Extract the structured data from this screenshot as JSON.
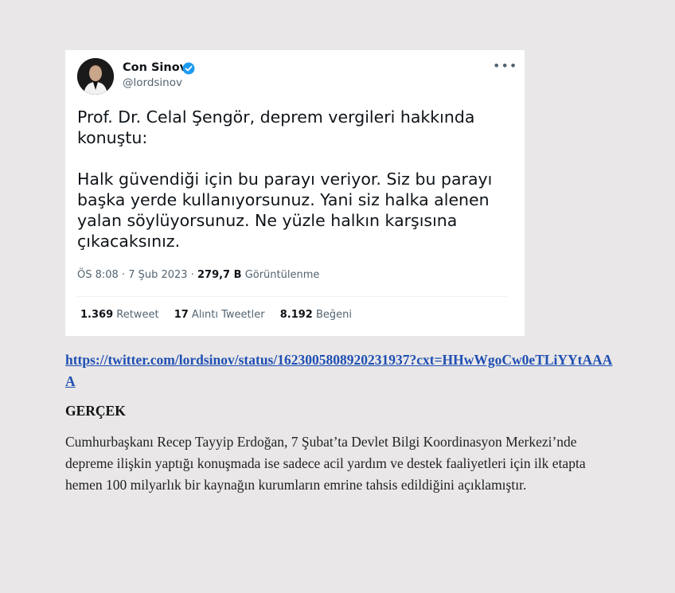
{
  "tweet": {
    "author_name": "Con Sinov",
    "author_handle": "@lordsinov",
    "more_icon": "more-horizontal-icon",
    "verified_icon": "verified-badge-icon",
    "verified_color": "#1d9bf0",
    "text_paragraphs": [
      "Prof. Dr. Celal Şengör, deprem vergileri hakkında konuştu:",
      "Halk güvendiği için bu parayı veriyor. Siz bu parayı başka yerde kullanıyorsunuz. Yani siz halka alenen yalan söylüyorsunuz. Ne yüzle halkın karşısına çıkacaksınız."
    ],
    "timestamp": "ÖS 8:08 · 7 Şub 2023 ·",
    "views_count": "279,7 B",
    "views_label": "Görüntülenme",
    "stats": [
      {
        "count": "1.369",
        "label": "Retweet"
      },
      {
        "count": "17",
        "label": "Alıntı Tweetler"
      },
      {
        "count": "8.192",
        "label": "Beğeni"
      }
    ]
  },
  "source_link": "https://twitter.com/lordsinov/status/1623005808920231937?cxt=HHwWgoCw0eTLiYYtAAAA",
  "section_heading": "GERÇEK",
  "body_text": "Cumhurbaşkanı Recep Tayyip Erdoğan, 7 Şubat’ta Devlet Bilgi Koordinasyon Merkezi’nde depreme ilişkin yaptığı konuşmada ise sadece acil yardım ve destek faaliyetleri için ilk etapta hemen 100 milyarlık bir kaynağın kurumların emrine tahsis edildiğini açıklamıştır."
}
